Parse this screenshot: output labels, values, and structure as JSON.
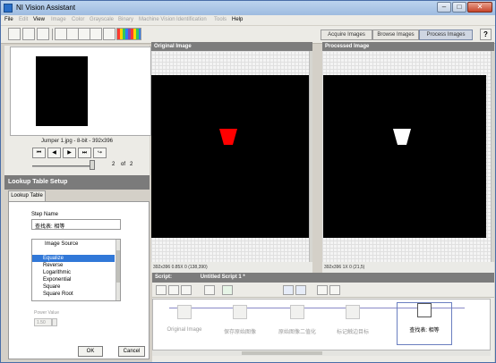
{
  "window": {
    "title": "NI Vision Assistant",
    "min_glyph": "–",
    "max_glyph": "□",
    "close_glyph": "✕"
  },
  "menu": {
    "items": [
      {
        "label": "File",
        "enabled": true
      },
      {
        "label": "Edit",
        "enabled": false
      },
      {
        "label": "View",
        "enabled": true
      },
      {
        "label": "Image",
        "enabled": false
      },
      {
        "label": "Color",
        "enabled": false
      },
      {
        "label": "Grayscale",
        "enabled": false
      },
      {
        "label": "Binary",
        "enabled": false
      },
      {
        "label": "Machine Vision",
        "enabled": false
      },
      {
        "label": "Identification",
        "enabled": false
      },
      {
        "label": "Tools",
        "enabled": false
      },
      {
        "label": "Help",
        "enabled": true
      }
    ]
  },
  "toolbar": {
    "modes": [
      "Acquire Images",
      "Browse Images",
      "Process Images"
    ],
    "active_mode": "Process Images",
    "help_glyph": "?"
  },
  "browser": {
    "caption": "Jumper 1.jpg - 8-bit - 392x396",
    "nav": [
      "⏮",
      "◀",
      "▶",
      "⏭",
      "↪"
    ],
    "page_current": "2",
    "page_of": "of",
    "page_total": "2"
  },
  "setup": {
    "title": "Lookup Table Setup",
    "tab": "Lookup Table",
    "step_name_label": "Step Name",
    "step_name_value": "查找表: 相等",
    "source_header": "Image Source",
    "options": [
      "Equalize",
      "Reverse",
      "Logarithmic",
      "Exponential",
      "Square",
      "Square Root"
    ],
    "selected": "Equalize",
    "power_label": "Power Value",
    "power_value": "1.50",
    "ok": "OK",
    "cancel": "Cancel"
  },
  "original": {
    "header": "Original Image",
    "status": "392x396 0.85X 0      (138,390)",
    "object_color": "#ff0000"
  },
  "processed": {
    "header": "Processed Image",
    "status": "392x396 1X 0      (21,5)",
    "object_color": "#ffffff"
  },
  "script": {
    "label": "Script:",
    "name": "Untitled Script 1 *",
    "steps": [
      {
        "label": "Original Image",
        "current": false
      },
      {
        "label": "保存原始图像",
        "current": false
      },
      {
        "label": "原始图像二值化",
        "current": false
      },
      {
        "label": "标记触边目标",
        "current": false
      },
      {
        "label": "查找表: 相等",
        "current": true
      }
    ]
  }
}
